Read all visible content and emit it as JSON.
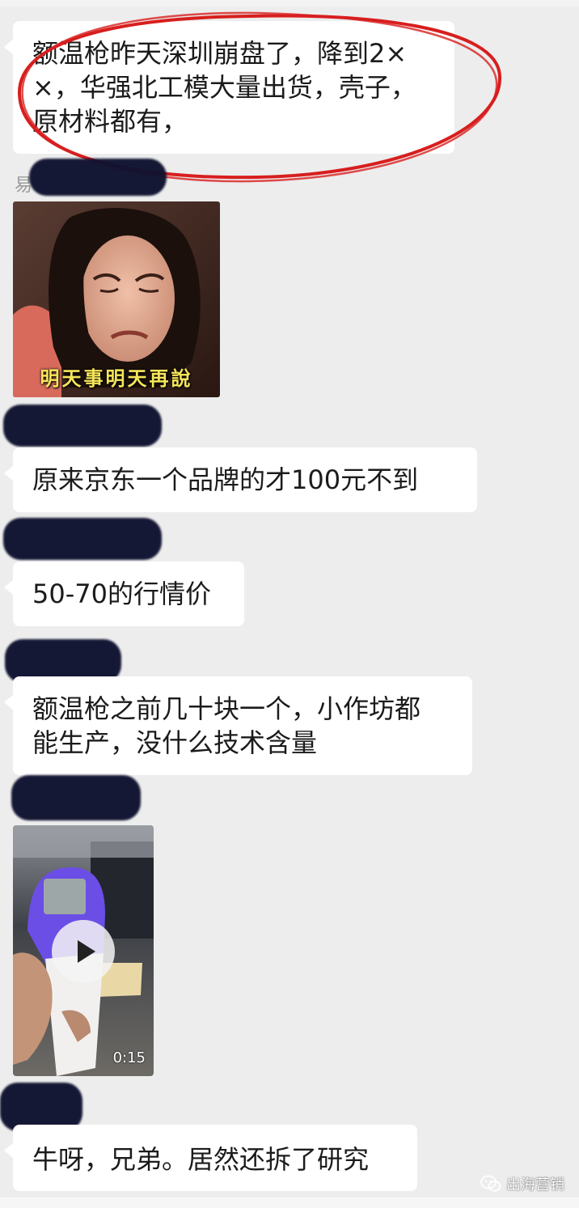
{
  "messages": {
    "m1": "额温枪昨天深圳崩盘了，降到2×\n×，华强北工模大量出货，壳子，\n原材料都有，",
    "m2": "原来京东一个品牌的才100元不到",
    "m3": "50-70的行情价",
    "m4": "额温枪之前几十块一个，小作坊都\n能生产，没什么技术含量",
    "m5": "牛呀，兄弟。居然还拆了研究"
  },
  "sender_fragment": "易",
  "meme": {
    "caption": "明天事明天再說"
  },
  "video": {
    "duration": "0:15"
  },
  "watermark": {
    "label": "出海营销",
    "icon": "wechat-icon"
  },
  "colors": {
    "background": "#ededed",
    "bubble": "#ffffff",
    "annotation": "#d81e1e",
    "redaction": "#0f1230"
  }
}
